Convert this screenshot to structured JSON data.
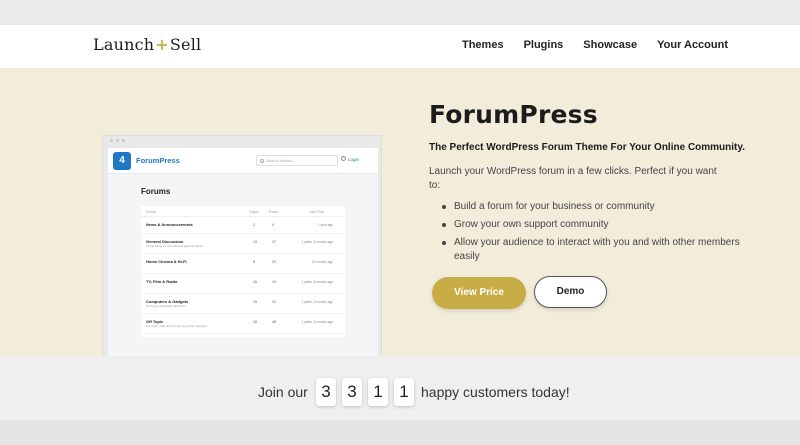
{
  "header": {
    "logo_left": "Launch",
    "logo_plus": "+",
    "logo_right": "Sell",
    "nav": [
      "Themes",
      "Plugins",
      "Showcase",
      "Your Account"
    ]
  },
  "hero": {
    "title": "ForumPress",
    "subtitle": "The Perfect WordPress Forum Theme For Your Online Community.",
    "intro": "Launch your WordPress forum in a few clicks. Perfect if you want to:",
    "bullets": [
      "Build a forum for your business or community",
      "Grow your own support community",
      "Allow your audience to interact with you and with other members easily"
    ],
    "primary_button": "View Price",
    "secondary_button": "Demo"
  },
  "mockup": {
    "brand_icon": "4",
    "brand": "ForumPress",
    "search_placeholder": "Search forums...",
    "login": "Login",
    "title": "Forums",
    "columns": [
      "Forum",
      "Topics",
      "Posts",
      "Last Post"
    ],
    "rows": [
      {
        "name": "News & Announcements",
        "desc": "",
        "topics": "2",
        "posts": "4",
        "last": "1 year ago"
      },
      {
        "name": "General Discussion",
        "desc": "Come hang out and discuss general topics.",
        "topics": "13",
        "posts": "27",
        "last": "1 years, 5 months ago"
      },
      {
        "name": "Home Cinema & Hi-Fi",
        "desc": "",
        "topics": "8",
        "posts": "22",
        "last": "23 months ago"
      },
      {
        "name": "TV, Film & Radio",
        "desc": "",
        "topics": "16",
        "posts": "19",
        "last": "1 years, 8 months ago"
      },
      {
        "name": "Computers & Gadgets",
        "desc": "All things computers and tech.",
        "topics": "19",
        "posts": "31",
        "last": "1 years, 9 months ago"
      },
      {
        "name": "Off Topic",
        "desc": "For topics that don't fit into any other category.",
        "topics": "18",
        "posts": "48",
        "last": "1 years, 9 months ago"
      }
    ]
  },
  "counter": {
    "prefix": "Join our",
    "digits": [
      "3",
      "3",
      "1",
      "1"
    ],
    "suffix": "happy customers today!"
  },
  "colors": {
    "accent": "#c8ad47",
    "hero_bg": "#f2ecda",
    "brand_blue": "#1e78c3"
  }
}
